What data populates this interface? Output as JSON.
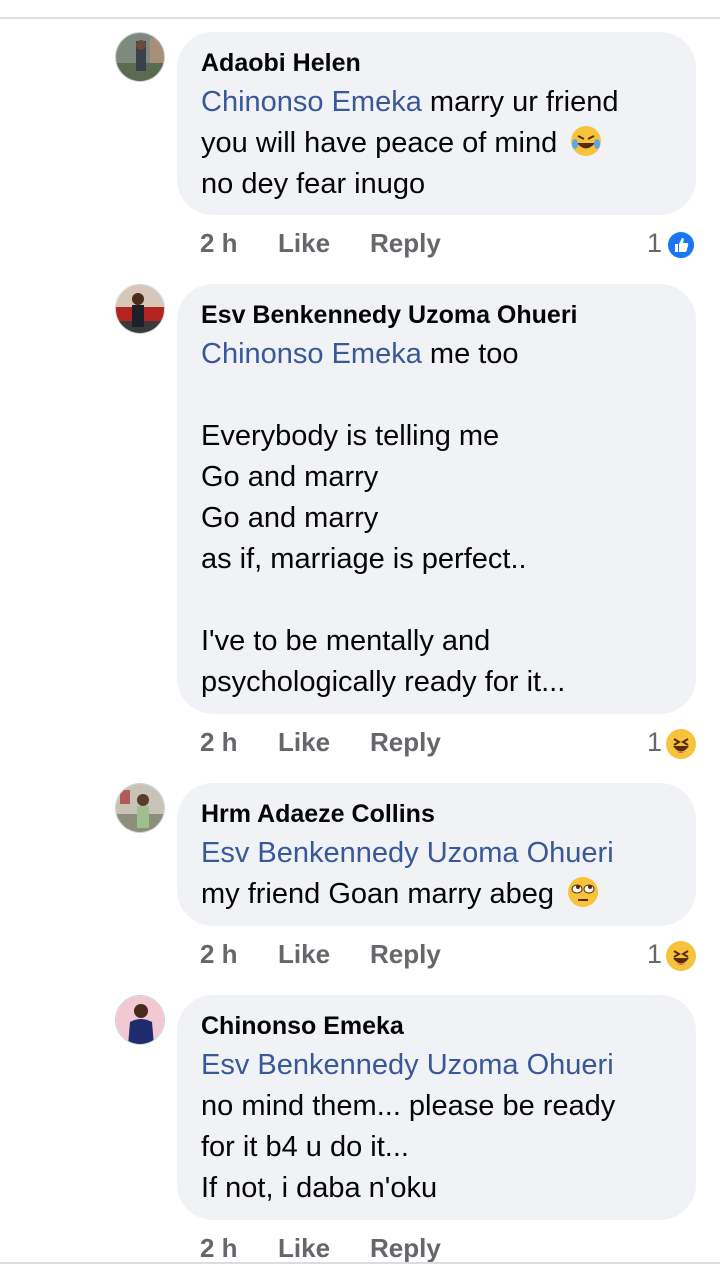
{
  "comments": [
    {
      "author": "Adaobi Helen",
      "mention": "Chinonso Emeka",
      "lines": [
        "marry ur friend",
        "you will have peace of mind",
        "no  dey fear inugo"
      ],
      "time": "2 h",
      "like_label": "Like",
      "reply_label": "Reply",
      "reaction_count": "1",
      "reaction": "like-reaction-icon"
    },
    {
      "author": "Esv Benkennedy Uzoma Ohueri",
      "mention": "Chinonso Emeka",
      "lines": [
        "me too",
        "",
        "Everybody is telling me",
        "Go and marry",
        "Go and marry",
        "as if, marriage is perfect..",
        "",
        "I've to be mentally and",
        "psychologically ready for it..."
      ],
      "time": "2 h",
      "like_label": "Like",
      "reply_label": "Reply",
      "reaction_count": "1",
      "reaction": "haha-reaction-icon"
    },
    {
      "author": "Hrm Adaeze Collins",
      "mention": "Esv Benkennedy Uzoma Ohueri",
      "lines": [
        "my friend Goan marry abeg"
      ],
      "time": "2 h",
      "like_label": "Like",
      "reply_label": "Reply",
      "reaction_count": "1",
      "reaction": "haha-reaction-icon"
    },
    {
      "author": "Chinonso Emeka",
      "mention": "Esv Benkennedy Uzoma Ohueri",
      "lines": [
        "no mind them... please be ready",
        "for it b4 u do it...",
        "If not, i daba n'oku"
      ],
      "time": "2 h",
      "like_label": "Like",
      "reply_label": "Reply"
    }
  ],
  "colors": {
    "mention": "#385898",
    "bubble": "#f0f2f5",
    "meta": "#65676b",
    "like_blue": "#1877f2",
    "haha_yellow": "#f7c33b"
  }
}
